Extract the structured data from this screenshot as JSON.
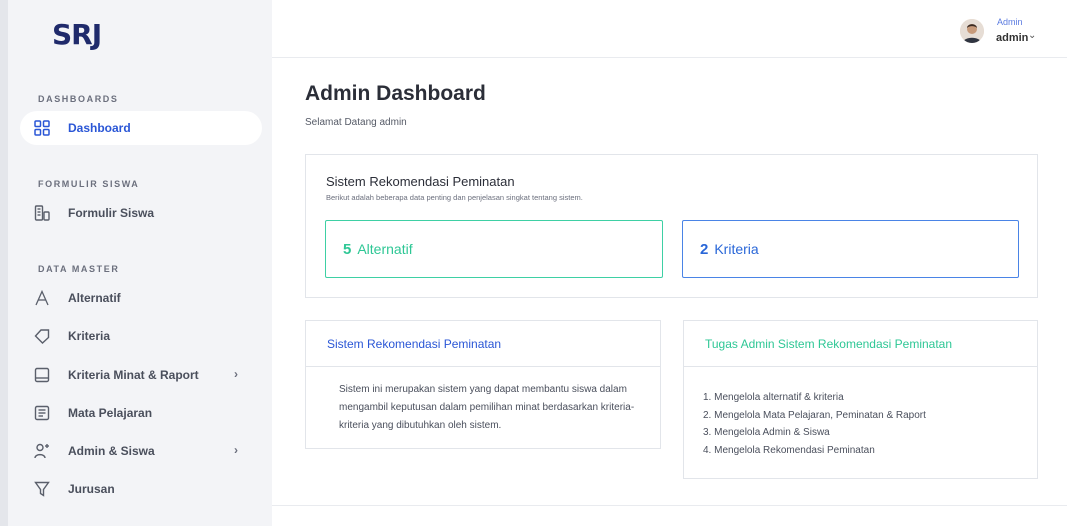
{
  "sidebar": {
    "logo": "SRJ",
    "sections": {
      "dashboards": "DASHBOARDS",
      "formulir": "FORMULIR SISWA",
      "master": "DATA MASTER"
    },
    "items": [
      {
        "label": "Dashboard",
        "icon": "grid-icon",
        "active": true
      },
      {
        "label": "Formulir Siswa",
        "icon": "form-icon"
      },
      {
        "label": "Alternatif",
        "icon": "letter-a-icon"
      },
      {
        "label": "Kriteria",
        "icon": "tag-icon"
      },
      {
        "label": "Kriteria Minat & Raport",
        "icon": "square-icon",
        "has_submenu": true
      },
      {
        "label": "Mata Pelajaran",
        "icon": "document-icon"
      },
      {
        "label": "Admin & Siswa",
        "icon": "user-add-icon",
        "has_submenu": true
      },
      {
        "label": "Jurusan",
        "icon": "filter-icon"
      }
    ],
    "chevron": "›"
  },
  "topbar": {
    "user_role": "Admin",
    "user_name": "admin",
    "caret": "⌄"
  },
  "page": {
    "title": "Admin Dashboard",
    "subtitle": "Selamat Datang admin"
  },
  "summary_card": {
    "title": "Sistem Rekomendasi Peminatan",
    "subtitle": "Berikut adalah beberapa data penting dan penjelasan singkat tentang sistem.",
    "stats": [
      {
        "count": "5",
        "label": "Alternatif",
        "color": "#2ec795"
      },
      {
        "count": "2",
        "label": "Kriteria",
        "color": "#2a67d8"
      }
    ]
  },
  "info_card": {
    "title": "Sistem Rekomendasi Peminatan",
    "body": "Sistem ini merupakan sistem yang dapat membantu siswa dalam mengambil keputusan dalam pemilihan minat berdasarkan kriteria-kriteria yang dibutuhkan oleh sistem."
  },
  "task_card": {
    "title": "Tugas Admin Sistem Rekomendasi Peminatan",
    "tasks": [
      "1. Mengelola alternatif & kriteria",
      "2. Mengelola Mata Pelajaran, Peminatan & Raport",
      "3. Mengelola Admin & Siswa",
      "4. Mengelola Rekomendasi Peminatan"
    ]
  },
  "colors": {
    "accent_blue": "#2a56d6",
    "accent_green": "#2ec795",
    "sidebar_bg": "#f3f4f7"
  }
}
